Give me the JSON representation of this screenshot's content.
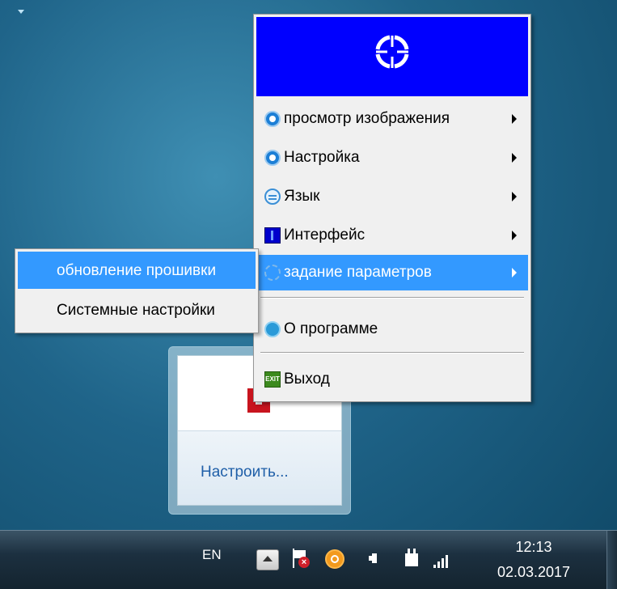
{
  "desktop": {
    "tray_flyout": {
      "customize_link": "Настроить...",
      "app_icon": "red-app-icon"
    }
  },
  "context_menu": {
    "banner_icon": "crosshair-icon",
    "items": [
      {
        "label": "просмотр изображения",
        "icon": "blue-round-icon",
        "has_submenu": true
      },
      {
        "label": "Настройка",
        "icon": "blue-round-icon",
        "has_submenu": true
      },
      {
        "label": "Язык",
        "icon": "language-icon",
        "has_submenu": true
      },
      {
        "label": "Интерфейс",
        "icon": "interface-icon",
        "has_submenu": true
      },
      {
        "label": "задание параметров",
        "icon": "parameters-icon",
        "has_submenu": true,
        "highlighted": true
      },
      {
        "label": "О программе",
        "icon": "about-icon",
        "has_submenu": false
      },
      {
        "label": "Выход",
        "icon": "exit-icon",
        "has_submenu": false,
        "icon_text": "EXIT"
      }
    ]
  },
  "submenu": {
    "items": [
      {
        "label": "обновление прошивки",
        "highlighted": true
      },
      {
        "label": "Системные настройки",
        "highlighted": false
      }
    ]
  },
  "taskbar": {
    "language": "EN",
    "time": "12:13",
    "date": "02.03.2017"
  },
  "colors": {
    "banner": "#0000ff",
    "highlight": "#3399ff"
  }
}
